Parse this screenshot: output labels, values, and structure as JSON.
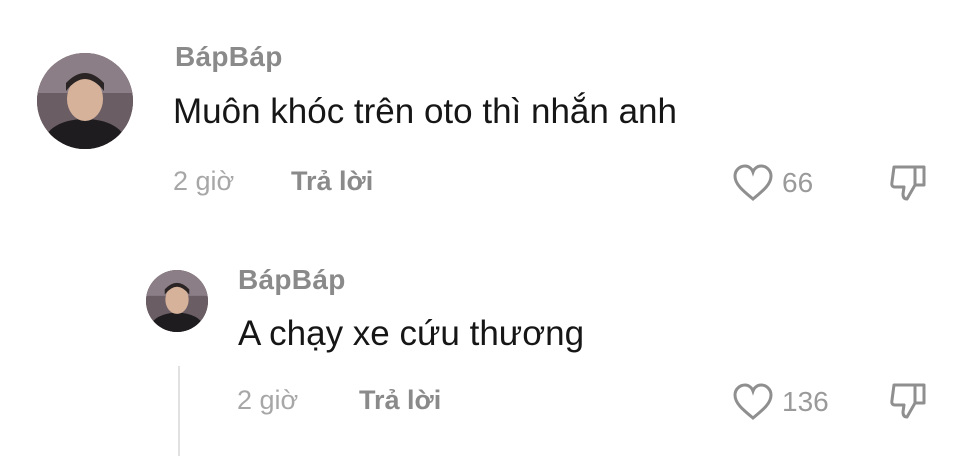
{
  "comments": [
    {
      "username": "BápBáp",
      "text": "Muôn khóc trên oto thì nhắn anh",
      "time": "2 giờ",
      "reply_label": "Trả lời",
      "likes": "66",
      "avatar_icon": "avatar",
      "like_icon": "heart-outline",
      "dislike_icon": "thumbs-down-outline"
    },
    {
      "username": "BápBáp",
      "text": "A chạy xe cứu thương",
      "time": "2 giờ",
      "reply_label": "Trả lời",
      "likes": "136",
      "avatar_icon": "avatar",
      "like_icon": "heart-outline",
      "dislike_icon": "thumbs-down-outline"
    }
  ],
  "colors": {
    "username": "#8a8a8a",
    "text": "#161616",
    "meta": "#a7a7a7",
    "icon": "#8f8f8f"
  }
}
